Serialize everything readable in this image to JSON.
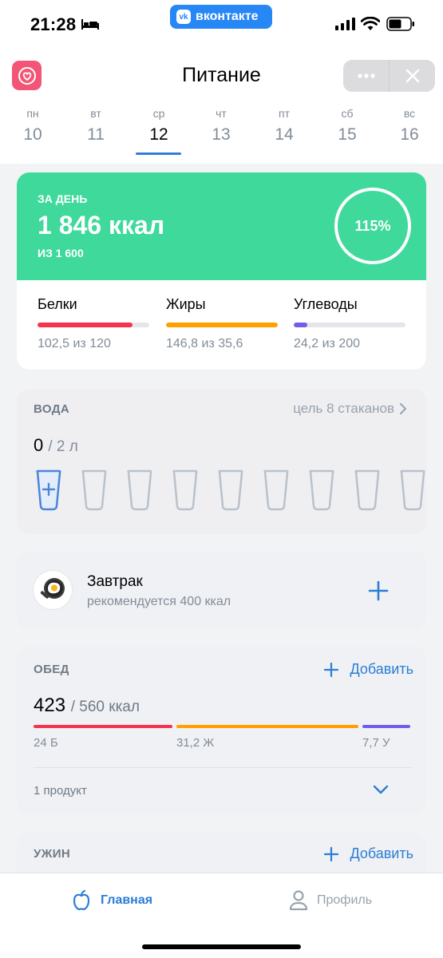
{
  "status_bar": {
    "time": "21:28",
    "app_pill": "вконтакте"
  },
  "header": {
    "title": "Питание"
  },
  "week": [
    {
      "name": "пн",
      "num": "10"
    },
    {
      "name": "вт",
      "num": "11"
    },
    {
      "name": "ср",
      "num": "12"
    },
    {
      "name": "чт",
      "num": "13"
    },
    {
      "name": "пт",
      "num": "14"
    },
    {
      "name": "сб",
      "num": "15"
    },
    {
      "name": "вс",
      "num": "16"
    }
  ],
  "summary": {
    "label": "ЗА ДЕНЬ",
    "value": "1 846 ккал",
    "goal": "ИЗ 1 600",
    "percent": "115%",
    "percent_value": 1.15,
    "accent": "#3fd99c",
    "macros": [
      {
        "name": "Белки",
        "value": "102,5 из 120",
        "fill": 0.85,
        "color": "#f5334d"
      },
      {
        "name": "Жиры",
        "value": "146,8 из 35,6",
        "fill": 1.0,
        "color": "#ffa000"
      },
      {
        "name": "Углеводы",
        "value": "24,2 из 200",
        "fill": 0.12,
        "color": "#735ce6"
      }
    ]
  },
  "water": {
    "title": "ВОДА",
    "goal_link": "цель 8 стаканов",
    "amount": "0",
    "unit": "/ 2 л",
    "glasses_filled": 0
  },
  "breakfast": {
    "name": "Завтрак",
    "recommend": "рекомендуется 400 ккал",
    "icon": "fried-egg-icon"
  },
  "lunch": {
    "title": "ОБЕД",
    "add_label": "Добавить",
    "kcal": "423",
    "kcal_of": "/ 560 ккал",
    "protein": "24 Б",
    "fat": "31,2 Ж",
    "carbs": "7,7 У",
    "products": "1 продукт"
  },
  "dinner": {
    "title": "УЖИН",
    "add_label": "Добавить"
  },
  "tabs": {
    "home": "Главная",
    "profile": "Профиль"
  },
  "colors": {
    "primary": "#2b7dd6",
    "background": "#f2f3f5"
  }
}
